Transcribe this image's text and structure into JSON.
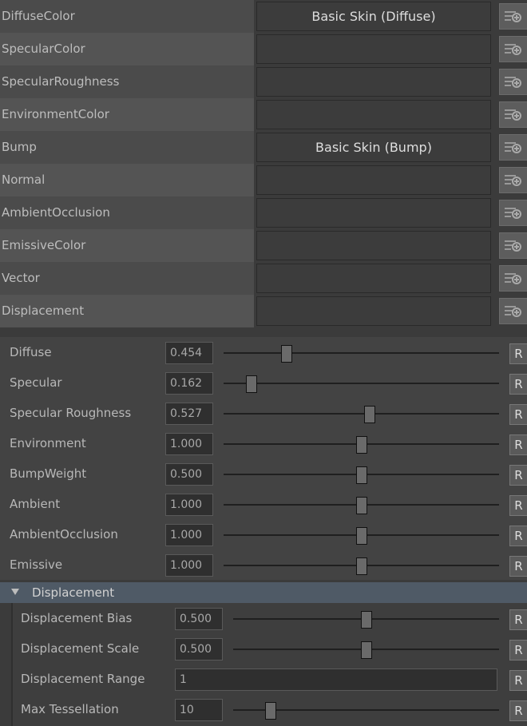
{
  "texture_slots": [
    {
      "label": "DiffuseColor",
      "value": "Basic Skin (Diffuse)"
    },
    {
      "label": "SpecularColor",
      "value": ""
    },
    {
      "label": "SpecularRoughness",
      "value": ""
    },
    {
      "label": "EnvironmentColor",
      "value": ""
    },
    {
      "label": "Bump",
      "value": "Basic Skin (Bump)"
    },
    {
      "label": "Normal",
      "value": ""
    },
    {
      "label": "AmbientOcclusion",
      "value": ""
    },
    {
      "label": "EmissiveColor",
      "value": ""
    },
    {
      "label": "Vector",
      "value": ""
    },
    {
      "label": "Displacement",
      "value": ""
    }
  ],
  "sliders": [
    {
      "label": "Diffuse",
      "value": "0.454",
      "level": 0.23,
      "reset": "R"
    },
    {
      "label": "Specular",
      "value": "0.162",
      "level": 0.1,
      "reset": "R"
    },
    {
      "label": "Specular Roughness",
      "value": "0.527",
      "level": 0.53,
      "reset": "R"
    },
    {
      "label": "Environment",
      "value": "1.000",
      "level": 0.5,
      "reset": "R"
    },
    {
      "label": "BumpWeight",
      "value": "0.500",
      "level": 0.5,
      "reset": "R"
    },
    {
      "label": "Ambient",
      "value": "1.000",
      "level": 0.5,
      "reset": "R"
    },
    {
      "label": "AmbientOcclusion",
      "value": "1.000",
      "level": 0.5,
      "reset": "R"
    },
    {
      "label": "Emissive",
      "value": "1.000",
      "level": 0.5,
      "reset": "R"
    }
  ],
  "displacement_section": {
    "title": "Displacement",
    "expanded": true,
    "rows": [
      {
        "label": "Displacement Bias",
        "value": "0.500",
        "level": 0.5,
        "reset": "R"
      },
      {
        "label": "Displacement Scale",
        "value": "0.500",
        "level": 0.5,
        "reset": "R"
      },
      {
        "label": "Displacement Range",
        "value": "1",
        "reset": "R"
      },
      {
        "label": "Max Tessellation",
        "value": "10",
        "level": 0.14,
        "reset": "R"
      }
    ]
  }
}
